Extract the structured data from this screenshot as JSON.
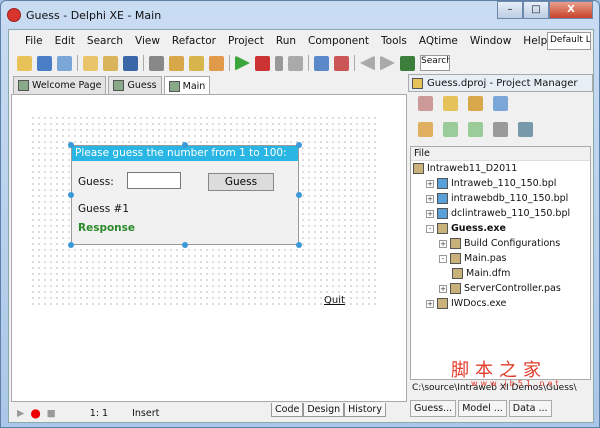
{
  "window": {
    "title": "Guess - Delphi XE - Main",
    "min": "–",
    "max": "□",
    "close": "X"
  },
  "menu": [
    "File",
    "Edit",
    "Search",
    "View",
    "Refactor",
    "Project",
    "Run",
    "Component",
    "Tools",
    "AQtime",
    "Window",
    "Help"
  ],
  "layout_combo": "Default Layout",
  "search_combo": "Search",
  "tabs": [
    "Welcome Page",
    "Guess",
    "Main"
  ],
  "form": {
    "caption": "Please guess the number from 1 to 100:",
    "guess_label": "Guess:",
    "guess_value": "",
    "button": "Guess",
    "count": "Guess #1",
    "response": "Response",
    "quit": "Quit"
  },
  "status": {
    "position": "1:  1",
    "mode": "Insert"
  },
  "bottom_tabs": [
    "Code",
    "Design",
    "History"
  ],
  "project_manager": {
    "title": "Guess.dproj - Project Manager",
    "column": "File",
    "nodes": [
      {
        "label": "Intraweb11_D2011",
        "level": 0,
        "exp": ""
      },
      {
        "label": "Intraweb_110_150.bpl",
        "level": 1,
        "exp": "+"
      },
      {
        "label": "intrawebdb_110_150.bpl",
        "level": 1,
        "exp": "+"
      },
      {
        "label": "dclintraweb_110_150.bpl",
        "level": 1,
        "exp": "+"
      },
      {
        "label": "Guess.exe",
        "level": 1,
        "exp": "-",
        "bold": true
      },
      {
        "label": "Build Configurations",
        "level": 2,
        "exp": "+"
      },
      {
        "label": "Main.pas",
        "level": 2,
        "exp": "-"
      },
      {
        "label": "Main.dfm",
        "level": 3,
        "exp": ""
      },
      {
        "label": "ServerController.pas",
        "level": 2,
        "exp": "+"
      },
      {
        "label": "IWDocs.exe",
        "level": 1,
        "exp": "+"
      }
    ],
    "path": "C:\\source\\Intraweb XI Demos\\Guess\\",
    "tabs": [
      "Guess...",
      "Model ...",
      "Data ..."
    ]
  },
  "watermark": {
    "cn": "脚本之家",
    "url": "www.jb51.net"
  }
}
